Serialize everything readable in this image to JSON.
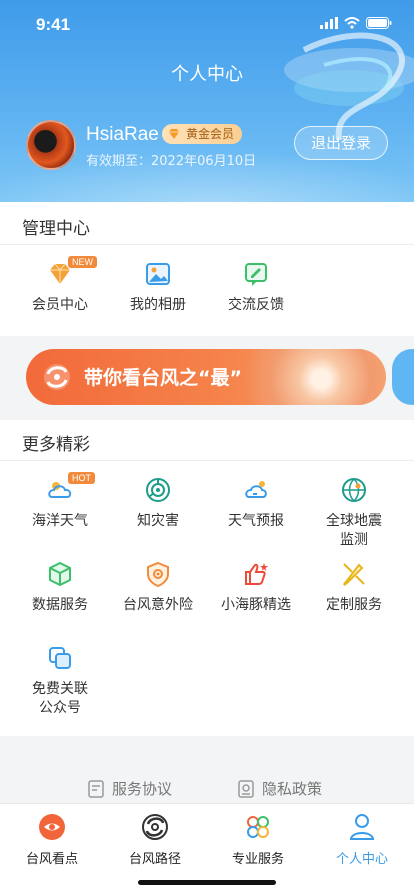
{
  "status_bar": {
    "time": "9:41"
  },
  "header": {
    "title": "个人中心",
    "username": "HsiaRae",
    "vip_label": "黄金会员",
    "expiry": "有效期至：2022年06月10日",
    "logout_label": "退出登录"
  },
  "management": {
    "title": "管理中心",
    "items": [
      {
        "label": "会员中心",
        "icon": "diamond-icon",
        "tag": "NEW"
      },
      {
        "label": "我的相册",
        "icon": "photo-album-icon"
      },
      {
        "label": "交流反馈",
        "icon": "feedback-icon"
      }
    ]
  },
  "banner": {
    "text": "带你看台风之“最”"
  },
  "more": {
    "title": "更多精彩",
    "items": [
      {
        "label": "海洋天气",
        "icon": "ocean-weather-icon",
        "tag": "HOT"
      },
      {
        "label": "知灾害",
        "icon": "disaster-icon"
      },
      {
        "label": "天气预报",
        "icon": "weather-forecast-icon"
      },
      {
        "label": "全球地震监测",
        "icon": "earthquake-globe-icon",
        "label_line1": "全球地震",
        "label_line2": "监测"
      },
      {
        "label": "数据服务",
        "icon": "data-cube-icon"
      },
      {
        "label": "台风意外险",
        "icon": "insurance-shield-icon"
      },
      {
        "label": "小海豚精选",
        "icon": "thumbs-up-icon"
      },
      {
        "label": "定制服务",
        "icon": "custom-pencil-icon"
      },
      {
        "label": "免费关联公众号",
        "icon": "link-account-icon",
        "label_line1": "免费关联",
        "label_line2": "公众号"
      }
    ]
  },
  "footer": {
    "terms": "服务协议",
    "privacy": "隐私政策"
  },
  "tabbar": {
    "tabs": [
      {
        "label": "台风看点",
        "icon": "typhoon-eye-icon"
      },
      {
        "label": "台风路径",
        "icon": "typhoon-path-icon"
      },
      {
        "label": "专业服务",
        "icon": "professional-service-icon"
      },
      {
        "label": "个人中心",
        "icon": "person-icon",
        "active": true
      }
    ]
  },
  "colors": {
    "accent": "#3a9ce8",
    "orange": "#f28a3b",
    "green": "#3dbf6a"
  }
}
